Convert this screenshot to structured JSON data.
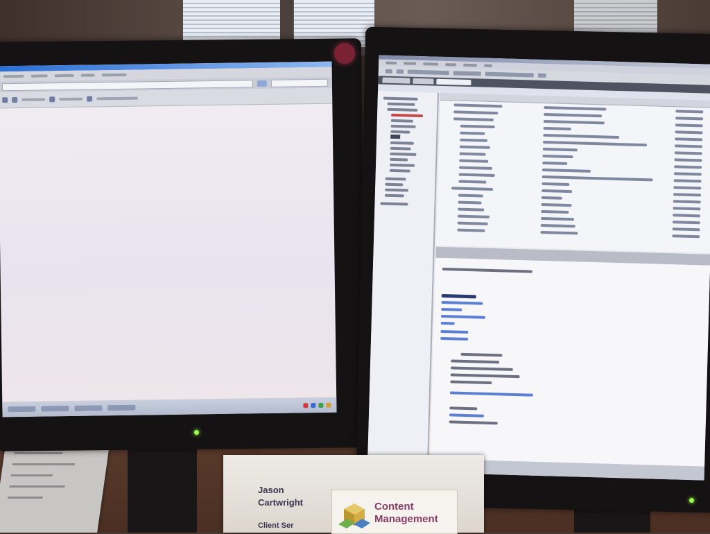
{
  "scene": {
    "description_tags": [
      "desk",
      "dual-monitors",
      "office"
    ]
  },
  "left_monitor": {
    "app": "web-browser",
    "page_state": "blank"
  },
  "right_monitor": {
    "app": "content-management-client"
  },
  "nameplate": {
    "person_first": "Jason",
    "person_last": "Cartwright",
    "subtitle": "Client Ser",
    "brand_line1": "Content",
    "brand_line2": "Management",
    "colors": {
      "brand": "#8a3d64",
      "name": "#3a3450"
    }
  },
  "icons": [
    "browser-logo-icon",
    "power-led-icon",
    "cube-logo-icon"
  ]
}
